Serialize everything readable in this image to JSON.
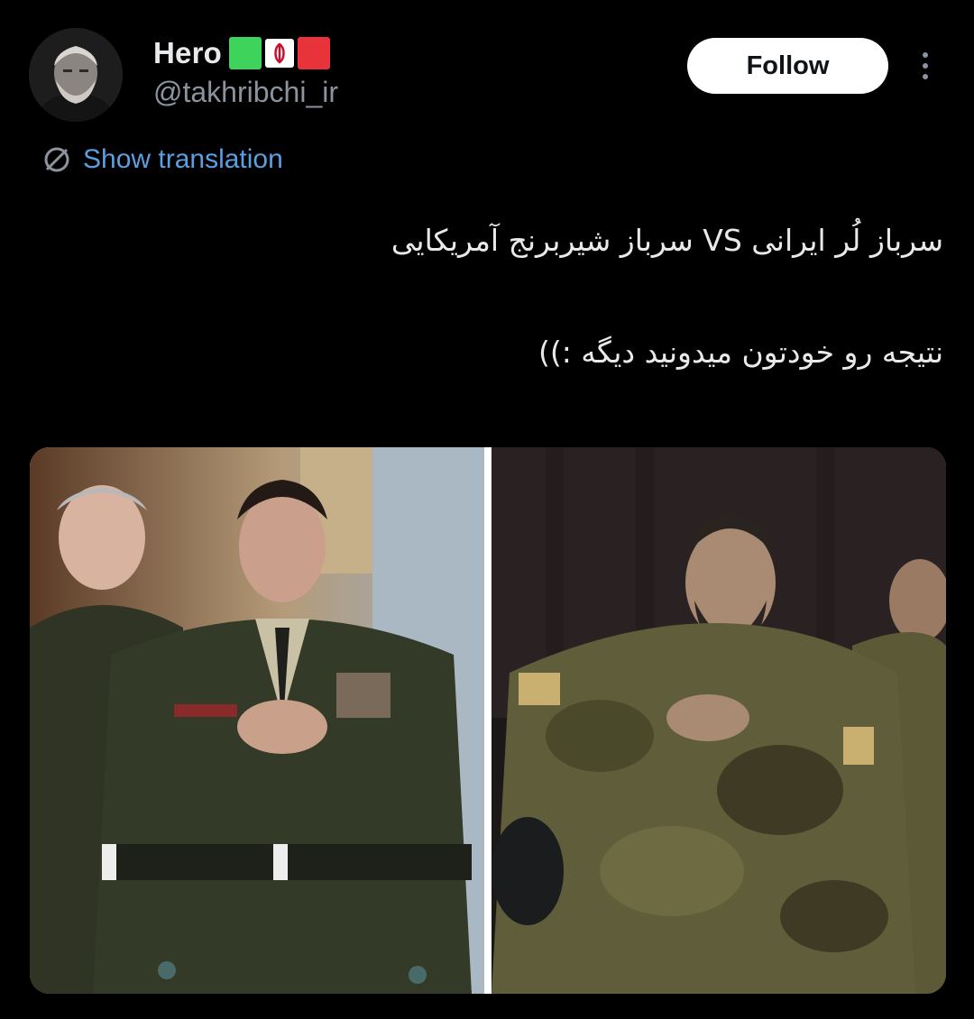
{
  "author": {
    "display_name": "Hero",
    "handle": "@takhribchi_ir",
    "avatar_icon": "avatar-portrait",
    "flag_icon": "iran-flag-icon",
    "flag_colors": [
      "#3ed35a",
      "#ffffff",
      "#e8333b"
    ]
  },
  "actions": {
    "follow_label": "Follow",
    "more_icon": "more-vertical-icon"
  },
  "translation": {
    "label": "Show translation",
    "icon": "translate-globe-icon"
  },
  "tweet": {
    "lines": [
      "سرباز لُر ایرانی VS سرباز شیربرنج آمریکایی",
      "",
      "نتیجه رو خودتون میدونید دیگه :))"
    ]
  },
  "media": {
    "images": [
      {
        "icon": "photo-us-soldiers"
      },
      {
        "icon": "photo-iranian-soldiers"
      }
    ]
  },
  "colors": {
    "background": "#000000",
    "text_primary": "#e7e9ea",
    "text_secondary": "#8b949e",
    "link": "#5b9fe0",
    "follow_bg": "#ffffff"
  }
}
